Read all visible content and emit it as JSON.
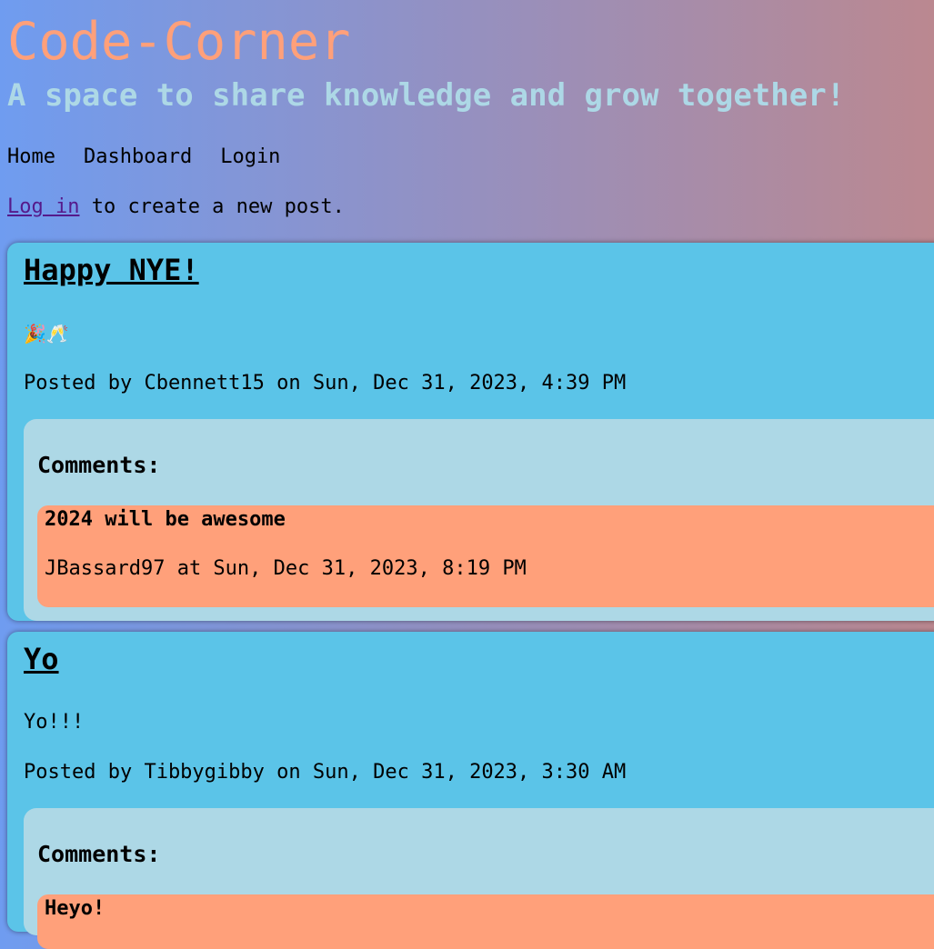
{
  "site": {
    "title": "Code-Corner",
    "tagline": "A space to share knowledge and grow together!"
  },
  "nav": {
    "items": [
      {
        "label": "Home"
      },
      {
        "label": "Dashboard"
      },
      {
        "label": "Login"
      }
    ]
  },
  "login_note": {
    "link_text": "Log in",
    "rest_text": " to create a new post."
  },
  "posts": [
    {
      "title": "Happy NYE!",
      "body": "🎉🥂",
      "meta": "Posted by Cbennett15 on Sun, Dec 31, 2023, 4:39 PM",
      "comments_heading": "Comments:",
      "comments": [
        {
          "text": "2024 will be awesome",
          "meta": "JBassard97 at Sun, Dec 31, 2023, 8:19 PM"
        }
      ]
    },
    {
      "title": "Yo",
      "body": "Yo!!!",
      "meta": "Posted by Tibbygibby on Sun, Dec 31, 2023, 3:30 AM",
      "comments_heading": "Comments:",
      "comments": [
        {
          "text": "Heyo!"
        }
      ]
    }
  ],
  "colors": {
    "title": "#ffa07a",
    "tagline": "#add8e6",
    "post_bg": "#5bc4e8",
    "comments_bg": "#add8e6",
    "comment_bg": "#ffa07a",
    "visited_link": "#551a8b"
  }
}
